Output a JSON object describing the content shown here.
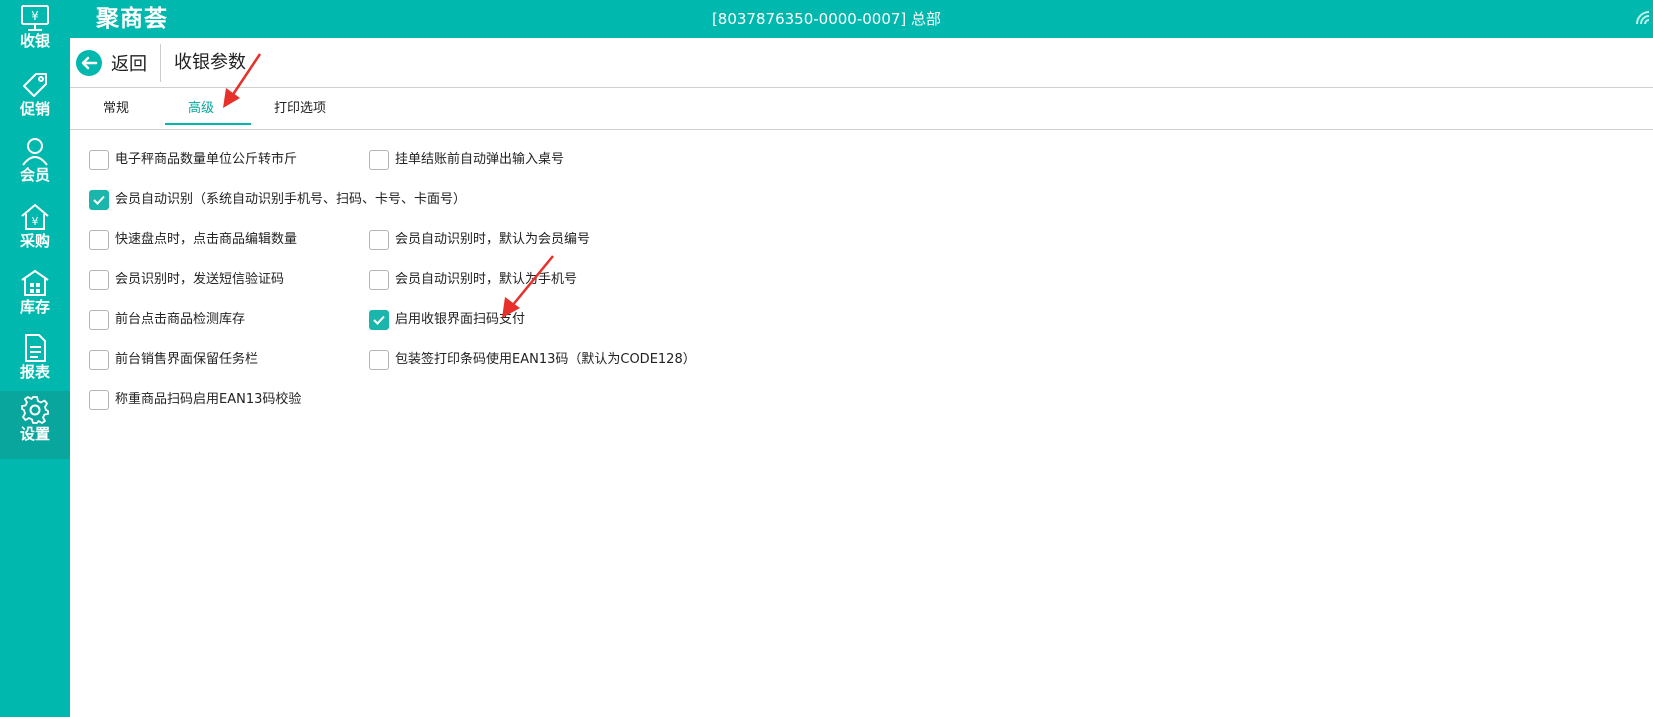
{
  "app": {
    "logo_text": "聚商荟",
    "store_label": "[8037876350-0000-0007] 总部",
    "colors": {
      "primary": "#00b8ae",
      "active_tab": "#00a89f",
      "checkbox_checked": "#1bb6ab",
      "annotation_arrow": "#e8302a"
    }
  },
  "sidebar": {
    "items": [
      {
        "label": "收银",
        "icon": "cashier-monitor-icon"
      },
      {
        "label": "促销",
        "icon": "tag-icon"
      },
      {
        "label": "会员",
        "icon": "person-icon"
      },
      {
        "label": "采购",
        "icon": "purchase-house-icon"
      },
      {
        "label": "库存",
        "icon": "warehouse-icon"
      },
      {
        "label": "报表",
        "icon": "report-document-icon"
      },
      {
        "label": "设置",
        "icon": "gear-icon",
        "active": true
      }
    ]
  },
  "header": {
    "back_label": "返回",
    "title": "收银参数"
  },
  "tabs": {
    "items": [
      {
        "label": "常规"
      },
      {
        "label": "高级",
        "active": true
      },
      {
        "label": "打印选项"
      }
    ]
  },
  "options": {
    "left": [
      {
        "label": "电子秤商品数量单位公斤转市斤",
        "checked": false
      },
      {
        "label": "会员自动识别（系统自动识别手机号、扫码、卡号、卡面号）",
        "checked": true
      },
      {
        "label": "快速盘点时，点击商品编辑数量",
        "checked": false
      },
      {
        "label": "会员识别时，发送短信验证码",
        "checked": false
      },
      {
        "label": "前台点击商品检测库存",
        "checked": false
      },
      {
        "label": "前台销售界面保留任务栏",
        "checked": false
      },
      {
        "label": "称重商品扫码启用EAN13码校验",
        "checked": false
      }
    ],
    "right": [
      {
        "label": "挂单结账前自动弹出输入桌号",
        "checked": false
      },
      {
        "label": "会员自动识别时，默认为会员编号",
        "checked": false
      },
      {
        "label": "会员自动识别时，默认为手机号",
        "checked": false
      },
      {
        "label": "启用收银界面扫码支付",
        "checked": true
      },
      {
        "label": "包装签打印条码使用EAN13码（默认为CODE128）",
        "checked": false
      }
    ]
  }
}
